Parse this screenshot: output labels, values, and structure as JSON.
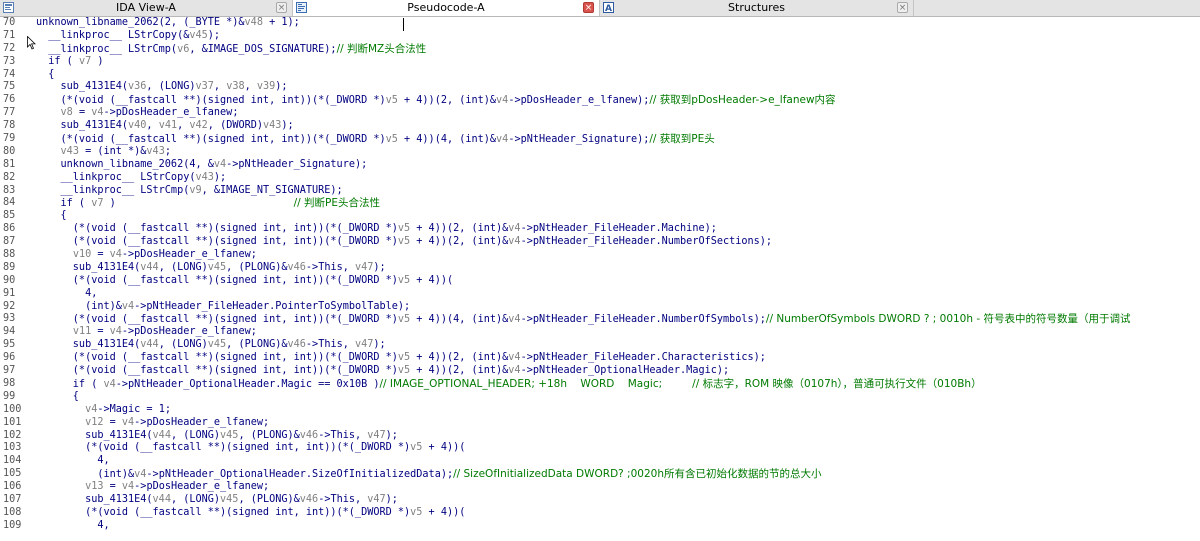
{
  "tabs": [
    {
      "label": "IDA View-A",
      "icon": "ida-view-icon",
      "active": false,
      "close": "gray"
    },
    {
      "label": "Pseudocode-A",
      "icon": "pseudocode-icon",
      "active": true,
      "close": "red"
    },
    {
      "label": "Structures",
      "icon": "structures-icon",
      "active": false,
      "close": "gray"
    }
  ],
  "colors": {
    "code": "#000080",
    "variable": "#808080",
    "comment": "#007a00"
  },
  "lines": [
    {
      "n": "70",
      "segs": [
        [
          "t",
          "unknown_libname_2062(2, (_BYTE *)&"
        ],
        [
          "v",
          "v48"
        ],
        [
          "t",
          " + 1);"
        ]
      ]
    },
    {
      "n": "71",
      "segs": [
        [
          "t",
          "  __linkproc__ LStrCopy(&"
        ],
        [
          "v",
          "v45"
        ],
        [
          "t",
          ");"
        ]
      ]
    },
    {
      "n": "72",
      "segs": [
        [
          "t",
          "  __linkproc__ LStrCmp("
        ],
        [
          "v",
          "v6"
        ],
        [
          "t",
          ", &IMAGE_DOS_SIGNATURE);"
        ],
        [
          "c",
          "// 判断MZ头合法性"
        ]
      ]
    },
    {
      "n": "73",
      "segs": [
        [
          "t",
          "  if ( "
        ],
        [
          "v",
          "v7"
        ],
        [
          "t",
          " )"
        ]
      ]
    },
    {
      "n": "74",
      "segs": [
        [
          "t",
          "  {"
        ]
      ]
    },
    {
      "n": "75",
      "segs": [
        [
          "t",
          "    sub_4131E4("
        ],
        [
          "v",
          "v36"
        ],
        [
          "t",
          ", (LONG)"
        ],
        [
          "v",
          "v37"
        ],
        [
          "t",
          ", "
        ],
        [
          "v",
          "v38"
        ],
        [
          "t",
          ", "
        ],
        [
          "v",
          "v39"
        ],
        [
          "t",
          ");"
        ]
      ]
    },
    {
      "n": "76",
      "segs": [
        [
          "t",
          "    (*(void (__fastcall **)(signed int, int))(*(_DWORD *)"
        ],
        [
          "v",
          "v5"
        ],
        [
          "t",
          " + 4))(2, (int)&"
        ],
        [
          "v",
          "v4"
        ],
        [
          "t",
          "->pDosHeader_e_lfanew);"
        ],
        [
          "c",
          "// 获取到pDosHeader->e_lfanew内容"
        ]
      ]
    },
    {
      "n": "77",
      "segs": [
        [
          "t",
          "    "
        ],
        [
          "v",
          "v8"
        ],
        [
          "t",
          " = "
        ],
        [
          "v",
          "v4"
        ],
        [
          "t",
          "->pDosHeader_e_lfanew;"
        ]
      ]
    },
    {
      "n": "78",
      "segs": [
        [
          "t",
          "    sub_4131E4("
        ],
        [
          "v",
          "v40"
        ],
        [
          "t",
          ", "
        ],
        [
          "v",
          "v41"
        ],
        [
          "t",
          ", "
        ],
        [
          "v",
          "v42"
        ],
        [
          "t",
          ", (DWORD)"
        ],
        [
          "v",
          "v43"
        ],
        [
          "t",
          ");"
        ]
      ]
    },
    {
      "n": "79",
      "segs": [
        [
          "t",
          "    (*(void (__fastcall **)(signed int, int))(*(_DWORD *)"
        ],
        [
          "v",
          "v5"
        ],
        [
          "t",
          " + 4))(4, (int)&"
        ],
        [
          "v",
          "v4"
        ],
        [
          "t",
          "->pNtHeader_Signature);"
        ],
        [
          "c",
          "// 获取到PE头"
        ]
      ]
    },
    {
      "n": "80",
      "segs": [
        [
          "t",
          "    "
        ],
        [
          "v",
          "v43"
        ],
        [
          "t",
          " = (int *)&"
        ],
        [
          "v",
          "v43"
        ],
        [
          "t",
          ";"
        ]
      ]
    },
    {
      "n": "81",
      "segs": [
        [
          "t",
          "    unknown_libname_2062(4, &"
        ],
        [
          "v",
          "v4"
        ],
        [
          "t",
          "->pNtHeader_Signature);"
        ]
      ]
    },
    {
      "n": "82",
      "segs": [
        [
          "t",
          "    __linkproc__ LStrCopy("
        ],
        [
          "v",
          "v43"
        ],
        [
          "t",
          ");"
        ]
      ]
    },
    {
      "n": "83",
      "segs": [
        [
          "t",
          "    __linkproc__ LStrCmp("
        ],
        [
          "v",
          "v9"
        ],
        [
          "t",
          ", &IMAGE_NT_SIGNATURE);"
        ]
      ]
    },
    {
      "n": "84",
      "segs": [
        [
          "t",
          "    if ( "
        ],
        [
          "v",
          "v7"
        ],
        [
          "t",
          " )                             "
        ],
        [
          "c",
          "// 判断PE头合法性"
        ]
      ]
    },
    {
      "n": "85",
      "segs": [
        [
          "t",
          "    {"
        ]
      ]
    },
    {
      "n": "86",
      "segs": [
        [
          "t",
          "      (*(void (__fastcall **)(signed int, int))(*(_DWORD *)"
        ],
        [
          "v",
          "v5"
        ],
        [
          "t",
          " + 4))(2, (int)&"
        ],
        [
          "v",
          "v4"
        ],
        [
          "t",
          "->pNtHeader_FileHeader.Machine);"
        ]
      ]
    },
    {
      "n": "87",
      "segs": [
        [
          "t",
          "      (*(void (__fastcall **)(signed int, int))(*(_DWORD *)"
        ],
        [
          "v",
          "v5"
        ],
        [
          "t",
          " + 4))(2, (int)&"
        ],
        [
          "v",
          "v4"
        ],
        [
          "t",
          "->pNtHeader_FileHeader.NumberOfSections);"
        ]
      ]
    },
    {
      "n": "88",
      "segs": [
        [
          "t",
          "      "
        ],
        [
          "v",
          "v10"
        ],
        [
          "t",
          " = "
        ],
        [
          "v",
          "v4"
        ],
        [
          "t",
          "->pDosHeader_e_lfanew;"
        ]
      ]
    },
    {
      "n": "89",
      "segs": [
        [
          "t",
          "      sub_4131E4("
        ],
        [
          "v",
          "v44"
        ],
        [
          "t",
          ", (LONG)"
        ],
        [
          "v",
          "v45"
        ],
        [
          "t",
          ", (PLONG)&"
        ],
        [
          "v",
          "v46"
        ],
        [
          "t",
          "->This, "
        ],
        [
          "v",
          "v47"
        ],
        [
          "t",
          ");"
        ]
      ]
    },
    {
      "n": "90",
      "segs": [
        [
          "t",
          "      (*(void (__fastcall **)(signed int, int))(*(_DWORD *)"
        ],
        [
          "v",
          "v5"
        ],
        [
          "t",
          " + 4))("
        ]
      ]
    },
    {
      "n": "91",
      "segs": [
        [
          "t",
          "        4,"
        ]
      ]
    },
    {
      "n": "92",
      "segs": [
        [
          "t",
          "        (int)&"
        ],
        [
          "v",
          "v4"
        ],
        [
          "t",
          "->pNtHeader_FileHeader.PointerToSymbolTable);"
        ]
      ]
    },
    {
      "n": "93",
      "segs": [
        [
          "t",
          "      (*(void (__fastcall **)(signed int, int))(*(_DWORD *)"
        ],
        [
          "v",
          "v5"
        ],
        [
          "t",
          " + 4))(4, (int)&"
        ],
        [
          "v",
          "v4"
        ],
        [
          "t",
          "->pNtHeader_FileHeader.NumberOfSymbols);"
        ],
        [
          "c",
          "// NumberOfSymbols DWORD ? ; 0010h - 符号表中的符号数量（用于调试"
        ]
      ]
    },
    {
      "n": "94",
      "segs": [
        [
          "t",
          "      "
        ],
        [
          "v",
          "v11"
        ],
        [
          "t",
          " = "
        ],
        [
          "v",
          "v4"
        ],
        [
          "t",
          "->pDosHeader_e_lfanew;"
        ]
      ]
    },
    {
      "n": "95",
      "segs": [
        [
          "t",
          "      sub_4131E4("
        ],
        [
          "v",
          "v44"
        ],
        [
          "t",
          ", (LONG)"
        ],
        [
          "v",
          "v45"
        ],
        [
          "t",
          ", (PLONG)&"
        ],
        [
          "v",
          "v46"
        ],
        [
          "t",
          "->This, "
        ],
        [
          "v",
          "v47"
        ],
        [
          "t",
          ");"
        ]
      ]
    },
    {
      "n": "96",
      "segs": [
        [
          "t",
          "      (*(void (__fastcall **)(signed int, int))(*(_DWORD *)"
        ],
        [
          "v",
          "v5"
        ],
        [
          "t",
          " + 4))(2, (int)&"
        ],
        [
          "v",
          "v4"
        ],
        [
          "t",
          "->pNtHeader_FileHeader.Characteristics);"
        ]
      ]
    },
    {
      "n": "97",
      "segs": [
        [
          "t",
          "      (*(void (__fastcall **)(signed int, int))(*(_DWORD *)"
        ],
        [
          "v",
          "v5"
        ],
        [
          "t",
          " + 4))(2, (int)&"
        ],
        [
          "v",
          "v4"
        ],
        [
          "t",
          "->pNtHeader_OptionalHeader.Magic);"
        ]
      ]
    },
    {
      "n": "98",
      "segs": [
        [
          "t",
          "      if ( "
        ],
        [
          "v",
          "v4"
        ],
        [
          "t",
          "->pNtHeader_OptionalHeader.Magic == 0x10B )"
        ],
        [
          "c",
          "// IMAGE_OPTIONAL_HEADER; +18h    WORD    Magic;         // 标志字，ROM 映像（0107h），普通可执行文件（010Bh）"
        ]
      ]
    },
    {
      "n": "99",
      "segs": [
        [
          "t",
          "      {"
        ]
      ]
    },
    {
      "n": "100",
      "segs": [
        [
          "t",
          "        "
        ],
        [
          "v",
          "v4"
        ],
        [
          "t",
          "->Magic = 1;"
        ]
      ]
    },
    {
      "n": "101",
      "segs": [
        [
          "t",
          "        "
        ],
        [
          "v",
          "v12"
        ],
        [
          "t",
          " = "
        ],
        [
          "v",
          "v4"
        ],
        [
          "t",
          "->pDosHeader_e_lfanew;"
        ]
      ]
    },
    {
      "n": "102",
      "segs": [
        [
          "t",
          "        sub_4131E4("
        ],
        [
          "v",
          "v44"
        ],
        [
          "t",
          ", (LONG)"
        ],
        [
          "v",
          "v45"
        ],
        [
          "t",
          ", (PLONG)&"
        ],
        [
          "v",
          "v46"
        ],
        [
          "t",
          "->This, "
        ],
        [
          "v",
          "v47"
        ],
        [
          "t",
          ");"
        ]
      ]
    },
    {
      "n": "103",
      "segs": [
        [
          "t",
          "        (*(void (__fastcall **)(signed int, int))(*(_DWORD *)"
        ],
        [
          "v",
          "v5"
        ],
        [
          "t",
          " + 4))("
        ]
      ]
    },
    {
      "n": "104",
      "segs": [
        [
          "t",
          "          4,"
        ]
      ]
    },
    {
      "n": "105",
      "segs": [
        [
          "t",
          "          (int)&"
        ],
        [
          "v",
          "v4"
        ],
        [
          "t",
          "->pNtHeader_OptionalHeader.SizeOfInitializedData);"
        ],
        [
          "c",
          "// SizeOfInitializedData DWORD? ;0020h所有含已初始化数据的节的总大小"
        ]
      ]
    },
    {
      "n": "106",
      "segs": [
        [
          "t",
          "        "
        ],
        [
          "v",
          "v13"
        ],
        [
          "t",
          " = "
        ],
        [
          "v",
          "v4"
        ],
        [
          "t",
          "->pDosHeader_e_lfanew;"
        ]
      ]
    },
    {
      "n": "107",
      "segs": [
        [
          "t",
          "        sub_4131E4("
        ],
        [
          "v",
          "v44"
        ],
        [
          "t",
          ", (LONG)"
        ],
        [
          "v",
          "v45"
        ],
        [
          "t",
          ", (PLONG)&"
        ],
        [
          "v",
          "v46"
        ],
        [
          "t",
          "->This, "
        ],
        [
          "v",
          "v47"
        ],
        [
          "t",
          ");"
        ]
      ]
    },
    {
      "n": "108",
      "segs": [
        [
          "t",
          "        (*(void (__fastcall **)(signed int, int))(*(_DWORD *)"
        ],
        [
          "v",
          "v5"
        ],
        [
          "t",
          " + 4))("
        ]
      ]
    },
    {
      "n": "109",
      "segs": [
        [
          "t",
          "          4,"
        ]
      ]
    }
  ]
}
